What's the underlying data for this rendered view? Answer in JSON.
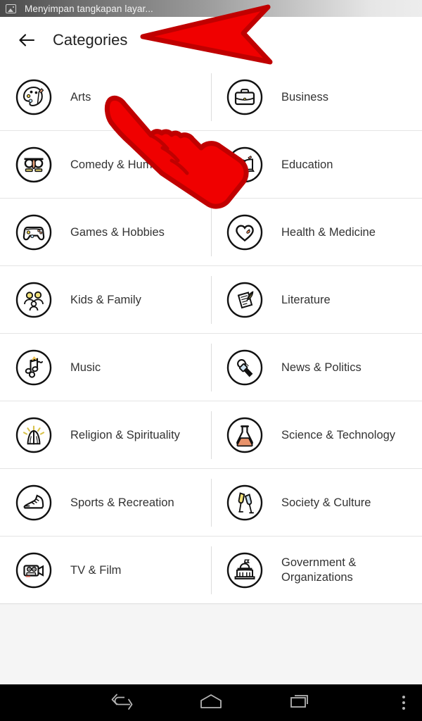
{
  "status_bar": {
    "icon": "screenshot-image-icon",
    "text": "Menyimpan tangkapan layar..."
  },
  "header": {
    "back_icon": "arrow-left-icon",
    "title": "Categories"
  },
  "categories": [
    {
      "label": "Arts",
      "icon": "palette-icon"
    },
    {
      "label": "Business",
      "icon": "briefcase-icon"
    },
    {
      "label": "Comedy & Humor",
      "icon": "groucho-glasses-icon"
    },
    {
      "label": "Education",
      "icon": "open-book-icon"
    },
    {
      "label": "Games & Hobbies",
      "icon": "gamepad-icon"
    },
    {
      "label": "Health & Medicine",
      "icon": "heart-icon"
    },
    {
      "label": "Kids & Family",
      "icon": "family-icon"
    },
    {
      "label": "Literature",
      "icon": "quill-paper-icon"
    },
    {
      "label": "Music",
      "icon": "music-notes-icon"
    },
    {
      "label": "News & Politics",
      "icon": "microphone-icon"
    },
    {
      "label": "Religion & Spirituality",
      "icon": "praying-hands-icon"
    },
    {
      "label": "Science & Technology",
      "icon": "flask-icon"
    },
    {
      "label": "Sports & Recreation",
      "icon": "running-shoe-icon"
    },
    {
      "label": "Society & Culture",
      "icon": "champagne-glasses-icon"
    },
    {
      "label": "TV & Film",
      "icon": "movie-camera-icon"
    },
    {
      "label": "Government & Organizations",
      "icon": "capitol-building-icon"
    }
  ],
  "nav_bar": {
    "back": "back-nav-icon",
    "home": "home-nav-icon",
    "recents": "recents-nav-icon",
    "menu": "overflow-menu-icon"
  },
  "annotations": {
    "arrow": "red-arrow-pointing-left",
    "hand": "red-pointing-hand-cursor"
  },
  "colors": {
    "annotation_fill": "#f00000",
    "annotation_stroke": "#c00000",
    "divider": "#e4e4e4",
    "text": "#333333",
    "empty_area": "#f5f5f5",
    "nav_bar": "#000000"
  }
}
